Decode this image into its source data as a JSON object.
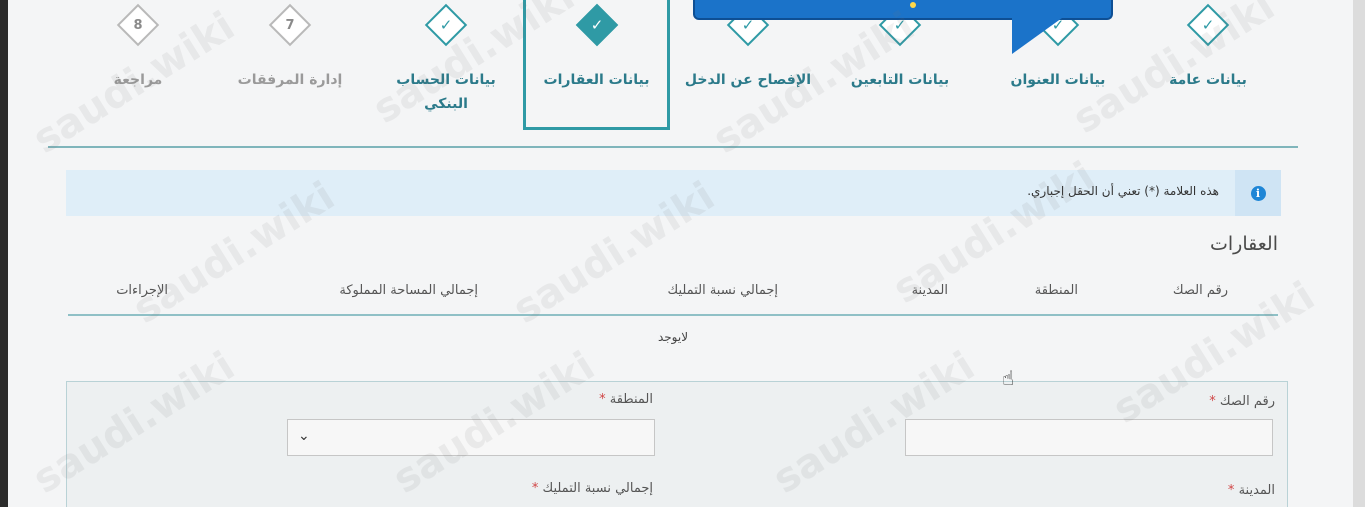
{
  "stepper": {
    "steps": [
      {
        "label": "بيانات عامة",
        "state": "done",
        "icon": "check-icon"
      },
      {
        "label": "بيانات العنوان",
        "state": "done",
        "icon": "check-icon"
      },
      {
        "label": "بيانات التابعين",
        "state": "done",
        "icon": "check-icon"
      },
      {
        "label": "الإفصاح عن الدخل",
        "state": "done",
        "icon": "check-icon"
      },
      {
        "label": "بيانات العقارات",
        "state": "active",
        "icon": "check-icon"
      },
      {
        "label": "بيانات الحساب البنكي",
        "state": "done",
        "icon": "check-icon"
      },
      {
        "label": "إدارة المرفقات",
        "state": "pending",
        "number": "7"
      },
      {
        "label": "مراجعة",
        "state": "pending",
        "number": "8"
      }
    ]
  },
  "alert": {
    "text": "هذه العلامة (*) تعني أن الحقل إجباري.",
    "icon": "info-icon"
  },
  "section": {
    "title": "العقارات"
  },
  "table": {
    "columns": [
      "رقم الصك",
      "المنطقة",
      "المدينة",
      "إجمالي نسبة التمليك",
      "إجمالي المساحة المملوكة",
      "الإجراءات"
    ],
    "empty_text": "لايوجد"
  },
  "form": {
    "deed_label": "رقم الصك",
    "region_label": "المنطقة",
    "city_label": "المدينة",
    "ownership_label": "إجمالي نسبة التمليك",
    "required_mark": "*",
    "deed_value": "",
    "region_value": ""
  },
  "watermark": "saudi.wiki",
  "colors": {
    "accent": "#2f9aa5",
    "alert_bg": "#dfeef8",
    "callout": "#1b73c9"
  }
}
